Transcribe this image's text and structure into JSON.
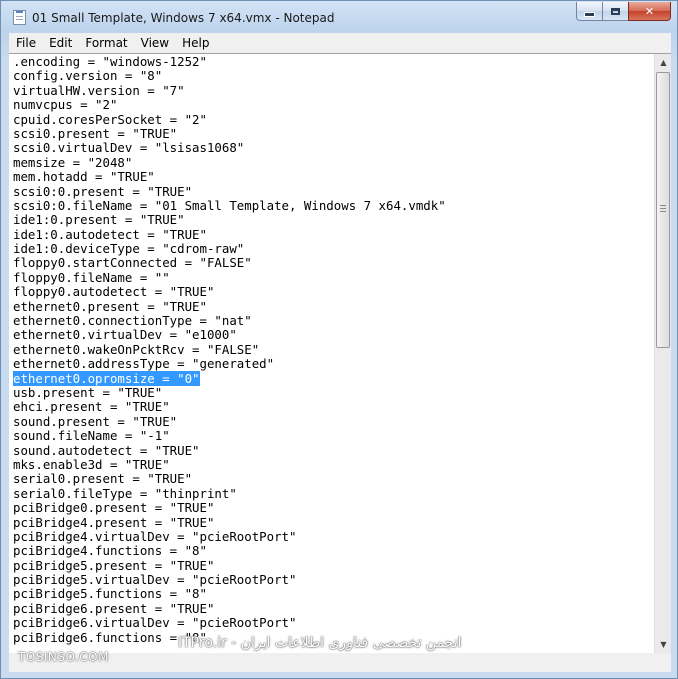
{
  "window": {
    "title": "01 Small Template, Windows 7 x64.vmx - Notepad"
  },
  "menu": [
    "File",
    "Edit",
    "Format",
    "View",
    "Help"
  ],
  "editor": {
    "selected_line_index": 22,
    "lines": [
      ".encoding = \"windows-1252\"",
      "config.version = \"8\"",
      "virtualHW.version = \"7\"",
      "numvcpus = \"2\"",
      "cpuid.coresPerSocket = \"2\"",
      "scsi0.present = \"TRUE\"",
      "scsi0.virtualDev = \"lsisas1068\"",
      "memsize = \"2048\"",
      "mem.hotadd = \"TRUE\"",
      "scsi0:0.present = \"TRUE\"",
      "scsi0:0.fileName = \"01 Small Template, Windows 7 x64.vmdk\"",
      "ide1:0.present = \"TRUE\"",
      "ide1:0.autodetect = \"TRUE\"",
      "ide1:0.deviceType = \"cdrom-raw\"",
      "floppy0.startConnected = \"FALSE\"",
      "floppy0.fileName = \"\"",
      "floppy0.autodetect = \"TRUE\"",
      "ethernet0.present = \"TRUE\"",
      "ethernet0.connectionType = \"nat\"",
      "ethernet0.virtualDev = \"e1000\"",
      "ethernet0.wakeOnPcktRcv = \"FALSE\"",
      "ethernet0.addressType = \"generated\"",
      "ethernet0.opromsize = \"0\"",
      "usb.present = \"TRUE\"",
      "ehci.present = \"TRUE\"",
      "sound.present = \"TRUE\"",
      "sound.fileName = \"-1\"",
      "sound.autodetect = \"TRUE\"",
      "mks.enable3d = \"TRUE\"",
      "serial0.present = \"TRUE\"",
      "serial0.fileType = \"thinprint\"",
      "pciBridge0.present = \"TRUE\"",
      "pciBridge4.present = \"TRUE\"",
      "pciBridge4.virtualDev = \"pcieRootPort\"",
      "pciBridge4.functions = \"8\"",
      "pciBridge5.present = \"TRUE\"",
      "pciBridge5.virtualDev = \"pcieRootPort\"",
      "pciBridge5.functions = \"8\"",
      "pciBridge6.present = \"TRUE\"",
      "pciBridge6.virtualDev = \"pcieRootPort\"",
      "pciBridge6.functions = \"8\""
    ]
  },
  "icons": {
    "app": "notepad-icon",
    "minimize": "minimize-icon",
    "maximize": "maximize-icon",
    "close": "close-icon"
  },
  "watermarks": {
    "left": "TOSINSO.COM",
    "right": "انجمن تخصصی فناوری اطلاعات ایران - ITPro.ir"
  },
  "colors": {
    "selection": "#3399ff",
    "close_button": "#c4422b"
  }
}
